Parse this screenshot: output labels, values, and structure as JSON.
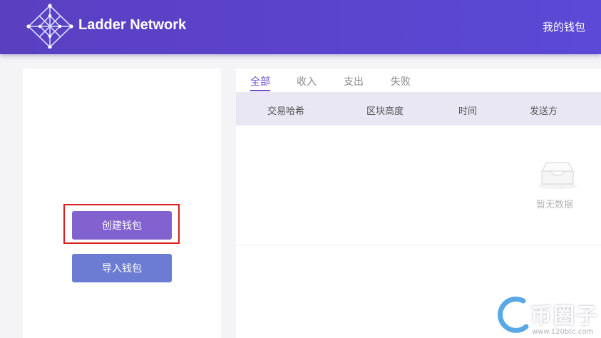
{
  "header": {
    "brand": "Ladder Network",
    "my_wallet": "我的钱包"
  },
  "left_panel": {
    "create_wallet": "创建钱包",
    "import_wallet": "导入钱包"
  },
  "tabs": [
    {
      "label": "全部",
      "active": true
    },
    {
      "label": "收入",
      "active": false
    },
    {
      "label": "支出",
      "active": false
    },
    {
      "label": "失败",
      "active": false
    }
  ],
  "table": {
    "columns": [
      "交易哈希",
      "区块高度",
      "时间",
      "发送方"
    ],
    "empty_text": "暂无数据"
  },
  "watermark": {
    "title": "币圈子",
    "url": "www.120btc.com"
  },
  "colors": {
    "header": "#5b43cc",
    "accent": "#6a4fd0",
    "create_button": "#8162cf",
    "import_button": "#6c7cd2",
    "highlight": "#d81e1e"
  }
}
